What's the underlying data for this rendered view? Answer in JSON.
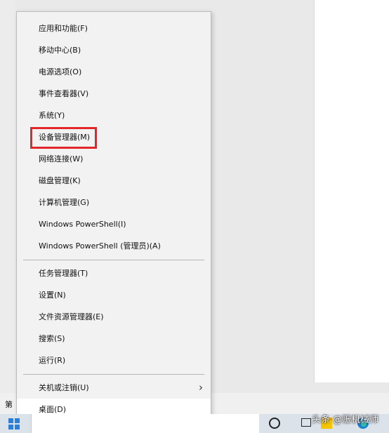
{
  "context_menu": {
    "group1": [
      {
        "label": "应用和功能(F)"
      },
      {
        "label": "移动中心(B)"
      },
      {
        "label": "电源选项(O)"
      },
      {
        "label": "事件查看器(V)"
      },
      {
        "label": "系统(Y)"
      },
      {
        "label": "设备管理器(M)",
        "highlighted": true
      },
      {
        "label": "网络连接(W)"
      },
      {
        "label": "磁盘管理(K)"
      },
      {
        "label": "计算机管理(G)"
      },
      {
        "label": "Windows PowerShell(I)"
      },
      {
        "label": "Windows PowerShell (管理员)(A)"
      }
    ],
    "group2": [
      {
        "label": "任务管理器(T)"
      },
      {
        "label": "设置(N)"
      },
      {
        "label": "文件资源管理器(E)"
      },
      {
        "label": "搜索(S)"
      },
      {
        "label": "运行(R)"
      }
    ],
    "group3": [
      {
        "label": "关机或注销(U)",
        "has_submenu": true,
        "icon": "chevron-right-icon"
      },
      {
        "label": "桌面(D)"
      }
    ]
  },
  "highlight_color": "#e3262a",
  "background_label": "第",
  "taskbar": {
    "start_icon": "windows-start-icon",
    "cortana_icon": "cortana-circle-icon",
    "task_view_icon": "task-view-icon",
    "apps": [
      "sticky-notes-icon",
      "edge-icon"
    ]
  },
  "watermark": "头条 @赈机械师"
}
